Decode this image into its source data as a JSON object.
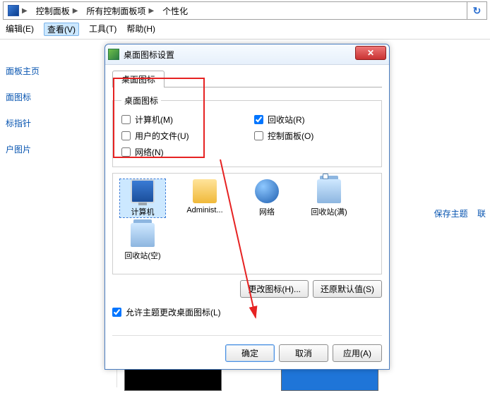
{
  "addr": {
    "seg1": "控制面板",
    "seg2": "所有控制面板项",
    "seg3": "个性化"
  },
  "menu": {
    "edit": "编辑(E)",
    "view": "查看(V)",
    "tools": "工具(T)",
    "help": "帮助(H)"
  },
  "side": {
    "home": "面板主页",
    "deskicon": "面图标",
    "pointer": "标指针",
    "userpic": "户图片"
  },
  "rightlinks": {
    "save": "保存主题",
    "online": "联"
  },
  "dlg": {
    "title": "桌面图标设置",
    "tab": "桌面图标",
    "legend": "桌面图标",
    "chk": {
      "computer": "计算机(M)",
      "userfiles": "用户的文件(U)",
      "network": "网络(N)",
      "recycle": "回收站(R)",
      "control": "控制面板(O)"
    },
    "icons": {
      "computer": "计算机",
      "admin": "Administ...",
      "network": "网络",
      "binfull": "回收站(满)",
      "binempty": "回收站(空)"
    },
    "btn": {
      "changeicon": "更改图标(H)...",
      "restore": "还原默认值(S)",
      "allow": "允许主题更改桌面图标(L)",
      "ok": "确定",
      "cancel": "取消",
      "apply": "应用(A)"
    }
  }
}
